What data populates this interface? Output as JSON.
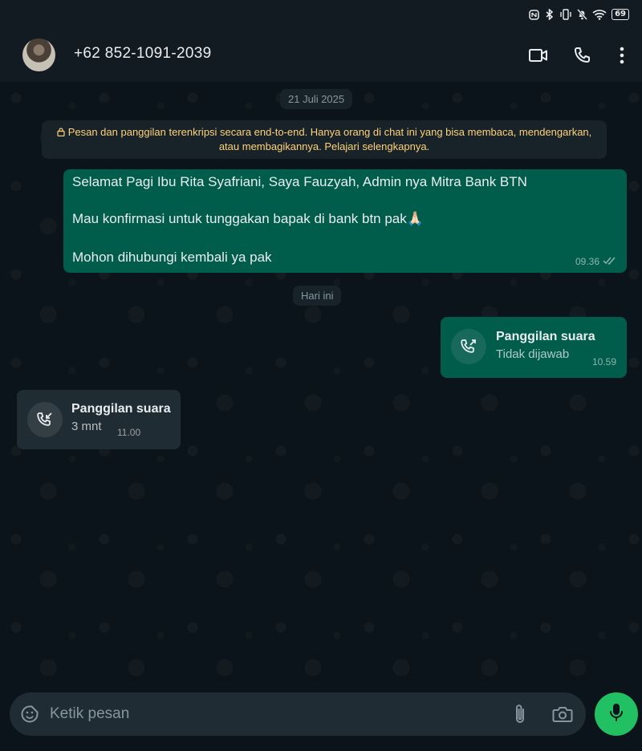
{
  "status_bar": {
    "battery_level": "69",
    "icons": [
      "nfc-icon",
      "bluetooth-icon",
      "vibrate-icon",
      "mute-icon",
      "wifi-icon",
      "battery-icon"
    ]
  },
  "header": {
    "contact_name": "+62 852-1091-2039",
    "actions": [
      "video-call-icon",
      "voice-call-icon",
      "more-options-icon"
    ]
  },
  "chat": {
    "date_chip_1": "21 Juli 2025",
    "encryption_notice": "Pesan dan panggilan terenkripsi secara end-to-end. Hanya orang di chat ini yang bisa membaca, mendengarkan, atau membagikannya. Pelajari selengkapnya.",
    "message_1": {
      "line_1": "Selamat Pagi Ibu Rita Syafriani, Saya Fauzyah, Admin nya Mitra Bank BTN",
      "line_2": "Mau konfirmasi untuk tunggakan bapak di bank btn pak🙏🏻",
      "line_3": "Mohon dihubungi kembali ya pak",
      "time": "09.36",
      "status": "read"
    },
    "date_chip_2": "Hari ini",
    "call_1": {
      "title": "Panggilan suara",
      "subtitle": "Tidak dijawab",
      "time": "10.59",
      "direction": "outgoing"
    },
    "call_2": {
      "title": "Panggilan suara",
      "subtitle": "3 mnt",
      "time": "11.00",
      "direction": "incoming"
    }
  },
  "input": {
    "placeholder": "Ketik pesan"
  },
  "colors": {
    "outgoing_bubble": "#005c4b",
    "incoming_bubble": "#202c33",
    "accent": "#21c063",
    "notice_text": "#ffd279"
  }
}
